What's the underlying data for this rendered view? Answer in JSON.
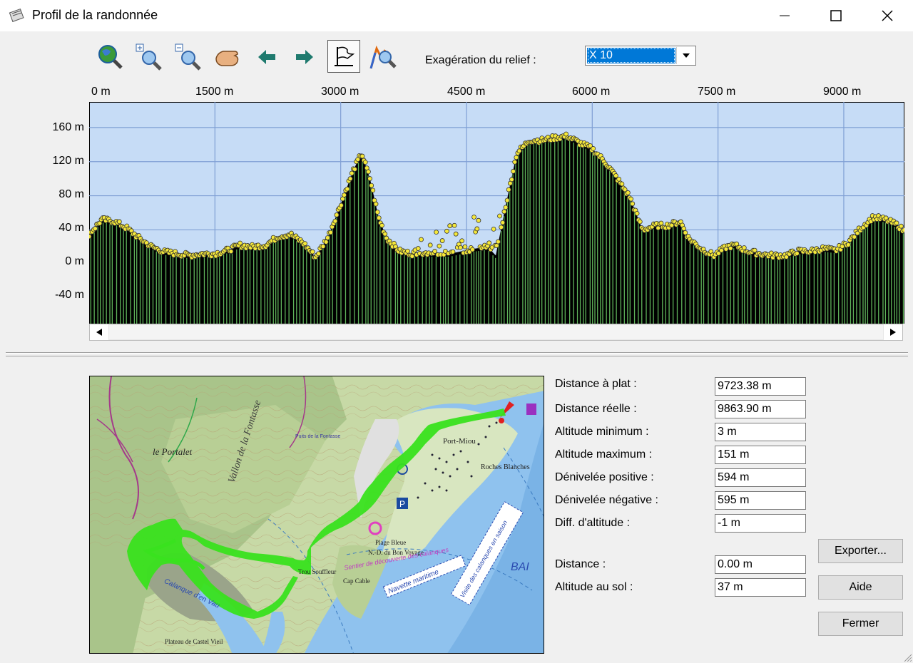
{
  "window": {
    "title": "Profil de la randonnée"
  },
  "toolbar": {
    "exaggeration_label": "Exagération du relief :",
    "exaggeration_value": "X 10"
  },
  "chart_data": {
    "type": "area",
    "x_ticks": [
      "0 m",
      "1500 m",
      "3000 m",
      "4500 m",
      "6000 m",
      "7500 m",
      "9000 m"
    ],
    "y_ticks": [
      "160 m",
      "120 m",
      "80 m",
      "40 m",
      "0 m",
      "-40 m"
    ],
    "xlim": [
      0,
      9723.38
    ],
    "ylim": [
      -70,
      190
    ],
    "x": [
      0,
      150,
      300,
      450,
      600,
      750,
      900,
      1050,
      1200,
      1350,
      1500,
      1650,
      1800,
      1950,
      2100,
      2250,
      2400,
      2550,
      2700,
      2850,
      3000,
      3150,
      3250,
      3350,
      3450,
      3550,
      3700,
      3850,
      4000,
      4150,
      4300,
      4450,
      4600,
      4750,
      4850,
      4950,
      5100,
      5250,
      5400,
      5550,
      5700,
      5850,
      6000,
      6150,
      6300,
      6450,
      6600,
      6750,
      6900,
      7050,
      7150,
      7300,
      7450,
      7600,
      7700,
      7850,
      8000,
      8150,
      8300,
      8450,
      8600,
      8750,
      8900,
      9050,
      9200,
      9350,
      9500,
      9650,
      9723
    ],
    "y": [
      35,
      52,
      50,
      42,
      30,
      20,
      14,
      12,
      10,
      12,
      12,
      16,
      22,
      20,
      22,
      32,
      35,
      25,
      8,
      32,
      70,
      110,
      130,
      100,
      55,
      30,
      15,
      12,
      12,
      12,
      12,
      15,
      18,
      20,
      10,
      60,
      130,
      145,
      145,
      148,
      150,
      142,
      135,
      120,
      100,
      78,
      40,
      45,
      45,
      50,
      30,
      18,
      10,
      20,
      22,
      15,
      12,
      10,
      10,
      15,
      15,
      18,
      16,
      25,
      42,
      55,
      52,
      45,
      38
    ],
    "grid": true
  },
  "stats": {
    "flat_distance_label": "Distance à plat :",
    "flat_distance": "9723.38 m",
    "real_distance_label": "Distance réelle :",
    "real_distance": "9863.90 m",
    "min_alt_label": "Altitude minimum :",
    "min_alt": "3 m",
    "max_alt_label": "Altitude maximum :",
    "max_alt": "151 m",
    "pos_gain_label": "Dénivelée positive :",
    "pos_gain": "594 m",
    "neg_gain_label": "Dénivelée négative :",
    "neg_gain": "595 m",
    "diff_label": "Diff. d'altitude :",
    "diff": "-1 m",
    "distance_label": "Distance :",
    "distance": "0.00 m",
    "ground_alt_label": "Altitude au sol :",
    "ground_alt": "37 m"
  },
  "buttons": {
    "export": "Exporter...",
    "help": "Aide",
    "close": "Fermer"
  },
  "map": {
    "labels": [
      "le Portalet",
      "Port-Miou",
      "Roches Blanches",
      "Plage Bleue",
      "N.-D. du Bon Voyage",
      "Cap Cable",
      "Navette maritime",
      "Visite des calanques en saison",
      "BAI",
      "Calanque d'en Vau",
      "Plateau de Castel Vieil",
      "Sentier de découverte des calanques",
      "Vallon de la Fontasse",
      "Puits de la Fontasse",
      "Trou Souffleur"
    ]
  }
}
